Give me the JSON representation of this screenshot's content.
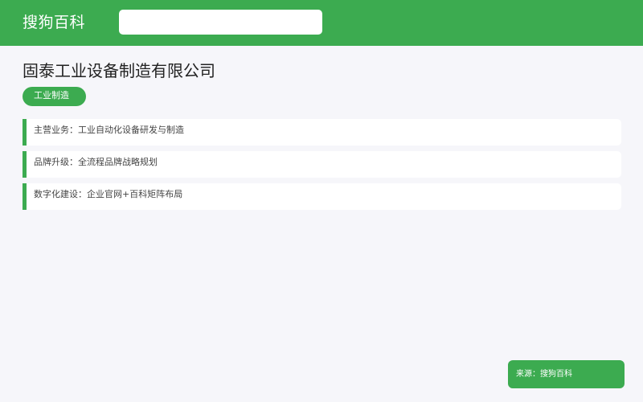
{
  "header": {
    "brand": "搜狗百科",
    "search_value": "",
    "search_placeholder": ""
  },
  "page": {
    "title": "固泰工业设备制造有限公司",
    "tag": "工业制造"
  },
  "info_cards": [
    {
      "label": "主营业务：",
      "value": "工业自动化设备研发与制造"
    },
    {
      "label": "品牌升级：",
      "value": "全流程品牌战略规划"
    },
    {
      "label": "数字化建设：",
      "value": "企业官网+百科矩阵布局"
    }
  ],
  "footer": {
    "source_label": "来源：",
    "source_value": "搜狗百科"
  },
  "colors": {
    "brand_green": "#3cab50",
    "background": "#f6f6fa"
  }
}
